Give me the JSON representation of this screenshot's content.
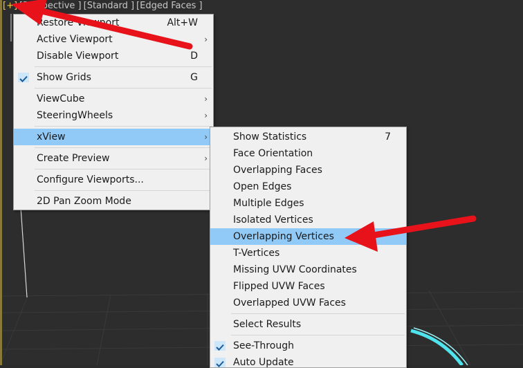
{
  "viewport_label": {
    "plus": "[+]",
    "view": "[Perspective ]",
    "shading": "[Standard ]",
    "mode": "[Edged Faces ]"
  },
  "menu_main": {
    "items": [
      {
        "label": "Restore Viewport",
        "shortcut": "Alt+W"
      },
      {
        "label": "Active Viewport",
        "shortcut": "›"
      },
      {
        "label": "Disable Viewport",
        "shortcut": "D"
      },
      {
        "label": "Show Grids",
        "shortcut": "G"
      },
      {
        "label": "ViewCube",
        "shortcut": "›"
      },
      {
        "label": "SteeringWheels",
        "shortcut": "›"
      },
      {
        "label": "xView",
        "shortcut": "›"
      },
      {
        "label": "Create Preview",
        "shortcut": "›"
      },
      {
        "label": "Configure Viewports...",
        "shortcut": ""
      },
      {
        "label": "2D Pan Zoom Mode",
        "shortcut": ""
      }
    ]
  },
  "menu_xview": {
    "items": [
      {
        "label": "Show Statistics",
        "shortcut": "7"
      },
      {
        "label": "Face Orientation"
      },
      {
        "label": "Overlapping Faces"
      },
      {
        "label": "Open Edges"
      },
      {
        "label": "Multiple Edges"
      },
      {
        "label": "Isolated Vertices"
      },
      {
        "label": "Overlapping Vertices"
      },
      {
        "label": "T-Vertices"
      },
      {
        "label": "Missing UVW Coordinates"
      },
      {
        "label": "Flipped UVW Faces"
      },
      {
        "label": "Overlapped UVW Faces"
      },
      {
        "label": "Select Results"
      },
      {
        "label": "See-Through"
      },
      {
        "label": "Auto Update"
      }
    ]
  },
  "colors": {
    "highlight": "#91c9f7",
    "annotation_arrow": "#e8121a",
    "highlight_object": "#4fe3ee"
  },
  "icons": {
    "check": "check-icon",
    "submenu": "chevron-right-icon"
  }
}
